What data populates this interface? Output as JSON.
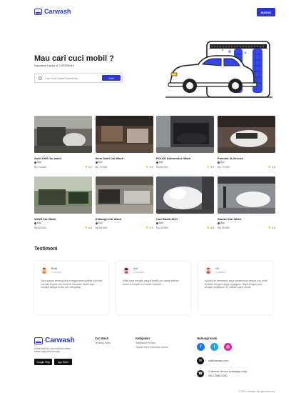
{
  "header": {
    "brand": "Carwash",
    "login_label": "MASUK"
  },
  "hero": {
    "title": "Mau cari cuci mobil ?",
    "subtitle": "Dapatkan hanya di CARWASH!",
    "search_placeholder": "Cari Cuci Mobil Favoritmu",
    "search_button": "Cari"
  },
  "cards": [
    {
      "name": "Auto 2000 Car wash",
      "location": "Bali",
      "price": "Rp 70.000",
      "rating": "4.2"
    },
    {
      "name": "Sima Sakti Car Wash",
      "location": "Bali",
      "price": "Rp 70.000",
      "rating": "4.5"
    },
    {
      "name": "POLKE Automotive Wash",
      "location": "Bali",
      "price": "Rp 50.000",
      "rating": "5.0"
    },
    {
      "name": "Pamuka Jk Service",
      "location": "Bali",
      "price": "Rp 70.000",
      "rating": "4.0"
    },
    {
      "name": "WiWit Car Wash",
      "location": "Bali",
      "price": "Rp 60.000",
      "rating": "4.8"
    },
    {
      "name": "Gilbaugh Car Wash",
      "location": "Bali",
      "price": "Rp 55.000",
      "rating": "4.3"
    },
    {
      "name": "Cuci Mobil ADO",
      "location": "Bali",
      "price": "Rp 35.000",
      "rating": "4.8"
    },
    {
      "name": "Sandro Car Wash",
      "location": "Bali",
      "price": "Rp 25.000",
      "rating": "4.5"
    }
  ],
  "testimoni": {
    "title": "Testimoni",
    "items": [
      {
        "name": "Budi",
        "role": "Customer",
        "text": "Saya sangat senang bisa menggunakan aplikasi ini untuk mencari tempat cuci mobil di Carwash. Mobil saya menjadi sangat bersih dan mengkilap."
      },
      {
        "name": "Ani",
        "role": "Customer",
        "text": "Mobil saya menjadi sangat bersih dan wangi setelah dicuci di tempat cuci mobil Carwash."
      },
      {
        "name": "Lili",
        "role": "Customer",
        "text": "Aplikasi ini membantu saya menemukan tempat cuci mobil terdekat dengan harga terjangkau. Saya sangat puas dengan pelayanan di Carwash yang ramah."
      }
    ]
  },
  "footer": {
    "brand": "Carwash",
    "description": "Solusi terbaik cuci mobil favoritmu kapan saja dimana saja.",
    "google_play": "Google Play",
    "app_store": "App Store",
    "col1": {
      "title": "Car Wash",
      "items": [
        "Tentang Kami"
      ]
    },
    "col2": {
      "title": "Kebijakan",
      "items": [
        "Kebijakan Privasi",
        "Syarat dan Ketentuan Umum"
      ]
    },
    "contact": {
      "title": "Hubungi Kami",
      "email": "cs@carwash.com",
      "phone_note": "Customer service (whatsapp only)",
      "phone": "0812-3888-0000"
    },
    "copyright": "© 2023 Carwash. All rights reserved."
  }
}
